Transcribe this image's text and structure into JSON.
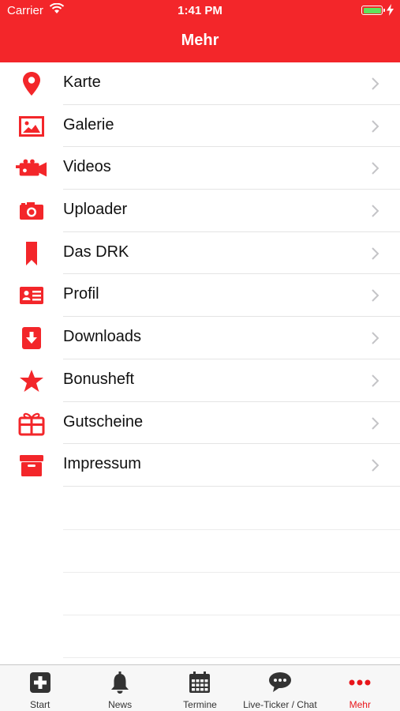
{
  "status": {
    "carrier": "Carrier",
    "time": "1:41 PM"
  },
  "header": {
    "title": "Mehr"
  },
  "menu": [
    {
      "label": "Karte",
      "icon": "map-pin-icon"
    },
    {
      "label": "Galerie",
      "icon": "picture-icon"
    },
    {
      "label": "Videos",
      "icon": "video-camera-icon"
    },
    {
      "label": "Uploader",
      "icon": "camera-icon"
    },
    {
      "label": "Das DRK",
      "icon": "bookmark-icon"
    },
    {
      "label": "Profil",
      "icon": "id-card-icon"
    },
    {
      "label": "Downloads",
      "icon": "download-icon"
    },
    {
      "label": "Bonusheft",
      "icon": "star-icon"
    },
    {
      "label": "Gutscheine",
      "icon": "gift-icon"
    },
    {
      "label": "Impressum",
      "icon": "archive-box-icon"
    }
  ],
  "tabs": [
    {
      "label": "Start",
      "icon": "plus-square-icon"
    },
    {
      "label": "News",
      "icon": "bell-icon"
    },
    {
      "label": "Termine",
      "icon": "calendar-icon"
    },
    {
      "label": "Live-Ticker / Chat",
      "icon": "chat-bubble-icon"
    },
    {
      "label": "Mehr",
      "icon": "more-dots-icon",
      "active": true
    }
  ],
  "colors": {
    "accent": "#f3262a",
    "active_tab": "#e8161b"
  }
}
